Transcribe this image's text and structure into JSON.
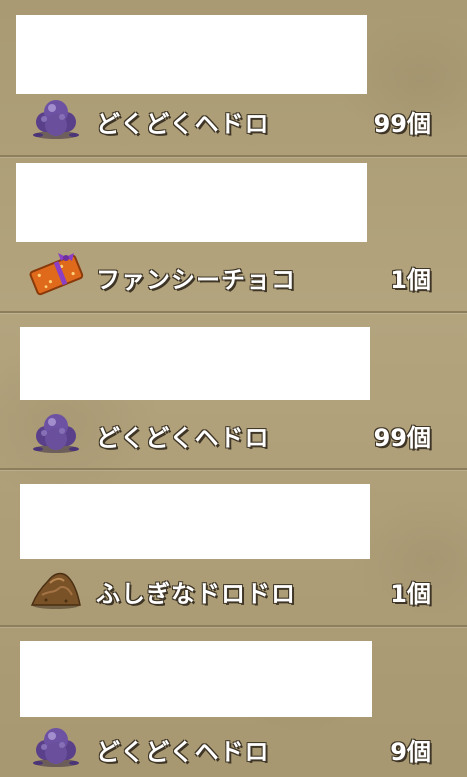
{
  "items": [
    {
      "name": "どくどくヘドロ",
      "quantity": "99個",
      "icon": "poison-sludge-icon"
    },
    {
      "name": "ファンシーチョコ",
      "quantity": "1個",
      "icon": "fancy-chocolate-icon"
    },
    {
      "name": "どくどくヘドロ",
      "quantity": "99個",
      "icon": "poison-sludge-icon"
    },
    {
      "name": "ふしぎなドロドロ",
      "quantity": "1個",
      "icon": "mysterious-mud-icon"
    },
    {
      "name": "どくどくヘドロ",
      "quantity": "9個",
      "icon": "poison-sludge-icon"
    }
  ],
  "colors": {
    "background": "#b3a47e",
    "divider": "#8e7f5c",
    "text": "#ffffff",
    "text_outline": "#3e3526",
    "sludge": "#6a4f9c",
    "chocolate_box": "#e06a1c",
    "ribbon": "#8b3fc4",
    "mud": "#7a5228"
  }
}
